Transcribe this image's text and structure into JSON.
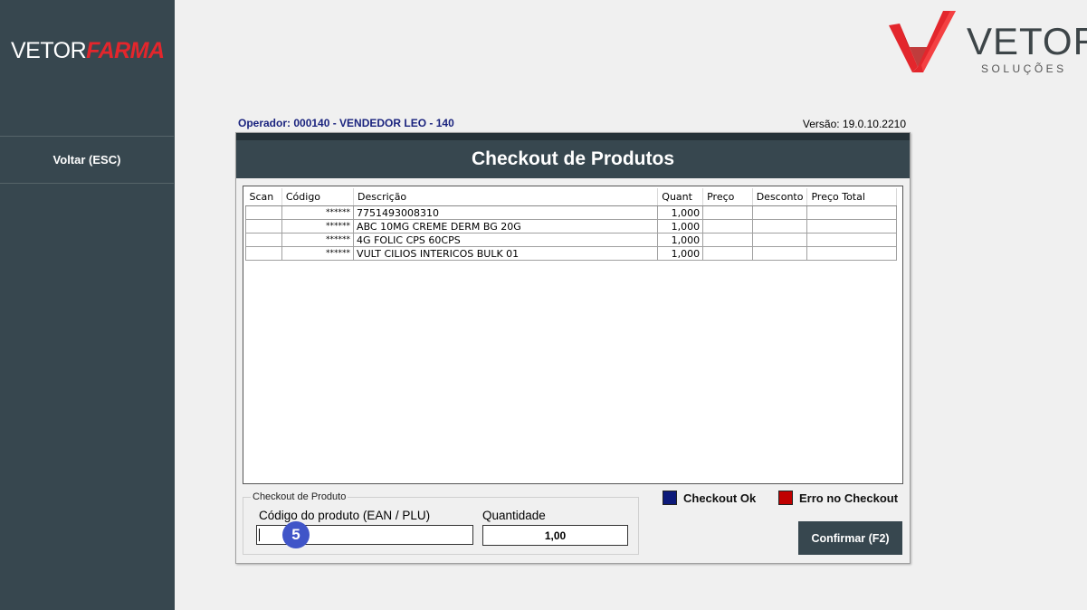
{
  "sidebar": {
    "brand_part1": "VETOR",
    "brand_part2": "FARMA",
    "back_label": "Voltar (ESC)"
  },
  "logo": {
    "wordmark": "VETOR",
    "tagline": "SOLUÇÕES",
    "accent": "#e3262c"
  },
  "header": {
    "operator": "Operador: 000140 - VENDEDOR LEO - 140",
    "version": "Versão: 19.0.10.2210"
  },
  "dialog": {
    "title": "Checkout de Produtos",
    "columns": [
      "Scan",
      "Código",
      "Descrição",
      "Quant",
      "Preço",
      "Desconto",
      "Preço Total"
    ],
    "rows": [
      {
        "scan": "",
        "codigo": "******",
        "descricao": "7751493008310",
        "quant": "1,000",
        "preco": "",
        "desconto": "",
        "total": ""
      },
      {
        "scan": "",
        "codigo": "******",
        "descricao": "ABC 10MG CREME DERM BG 20G",
        "quant": "1,000",
        "preco": "",
        "desconto": "",
        "total": ""
      },
      {
        "scan": "",
        "codigo": "******",
        "descricao": "4G FOLIC CPS 60CPS",
        "quant": "1,000",
        "preco": "",
        "desconto": "",
        "total": ""
      },
      {
        "scan": "",
        "codigo": "******",
        "descricao": "VULT CILIOS INTERICOS BULK 01",
        "quant": "1,000",
        "preco": "",
        "desconto": "",
        "total": ""
      }
    ],
    "group_title": "Checkout de Produto",
    "ean_label": "Código do produto (EAN / PLU)",
    "ean_value": "",
    "qty_label": "Quantidade",
    "qty_value": "1,00",
    "step_badge": "5",
    "legend_ok": "Checkout Ok",
    "legend_ok_color": "#0d1a7a",
    "legend_err": "Erro no Checkout",
    "legend_err_color": "#c00000",
    "confirm_label": "Confirmar (F2)"
  }
}
